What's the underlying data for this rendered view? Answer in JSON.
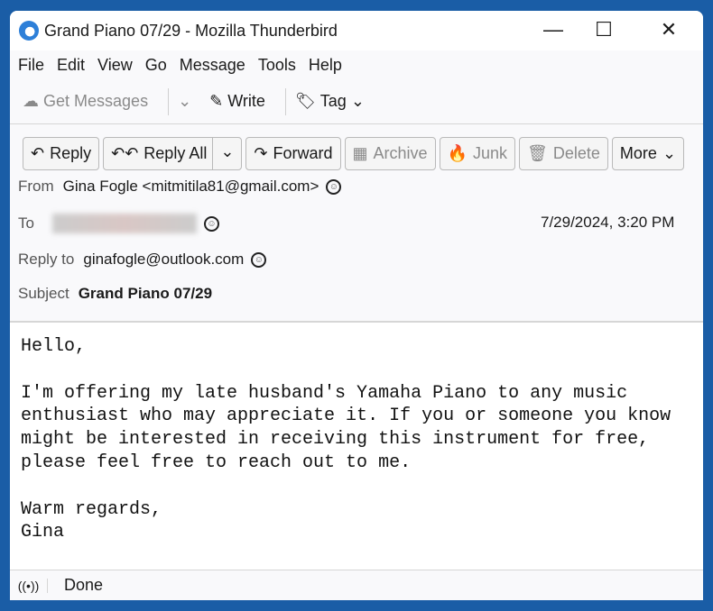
{
  "window": {
    "title": "Grand Piano 07/29 - Mozilla Thunderbird"
  },
  "menu": [
    "File",
    "Edit",
    "View",
    "Go",
    "Message",
    "Tools",
    "Help"
  ],
  "toolbar": {
    "get_messages": "Get Messages",
    "write": "Write",
    "tag": "Tag"
  },
  "actions": {
    "reply": "Reply",
    "reply_all": "Reply All",
    "forward": "Forward",
    "archive": "Archive",
    "junk": "Junk",
    "delete": "Delete",
    "more": "More"
  },
  "headers": {
    "from_label": "From",
    "from": "Gina Fogle <mitmitila81@gmail.com>",
    "to_label": "To",
    "date": "7/29/2024, 3:20 PM",
    "reply_to_label": "Reply to",
    "reply_to": "ginafogle@outlook.com",
    "subject_label": "Subject",
    "subject": "Grand Piano 07/29"
  },
  "body": "Hello,\n\nI'm offering my late husband's Yamaha Piano to any music\nenthusiast who may appreciate it. If you or someone you know\nmight be interested in receiving this instrument for free,\nplease feel free to reach out to me.\n\nWarm regards,\nGina",
  "status": {
    "text": "Done"
  }
}
